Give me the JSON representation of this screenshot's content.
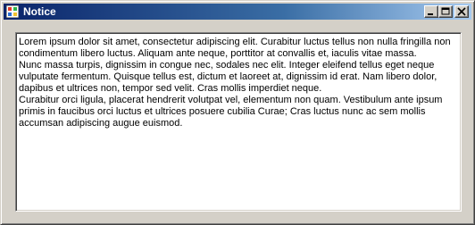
{
  "window": {
    "title": "Notice",
    "controls": {
      "minimize": "minimize-icon",
      "maximize": "maximize-icon",
      "close": "close-icon"
    }
  },
  "textbox": {
    "paragraphs": [
      "Lorem ipsum dolor sit amet, consectetur adipiscing elit. Curabitur luctus tellus non nulla fringilla non condimentum libero luctus. Aliquam ante neque, porttitor at convallis et, iaculis vitae massa.",
      "Nunc massa turpis, dignissim in congue nec, sodales nec elit. Integer eleifend tellus eget neque vulputate fermentum. Quisque tellus est, dictum et laoreet at, dignissim id erat. Nam libero dolor, dapibus et ultrices non, tempor sed velit. Cras mollis imperdiet neque.",
      "Curabitur orci ligula, placerat hendrerit volutpat vel, elementum non quam. Vestibulum ante ipsum primis in faucibus orci luctus et ultrices posuere cubilia Curae; Cras luctus nunc ac sem mollis accumsan adipiscing augue euismod."
    ]
  },
  "colors": {
    "titlebar_start": "#0a246a",
    "titlebar_end": "#a6caf0",
    "face": "#d4d0c8"
  }
}
